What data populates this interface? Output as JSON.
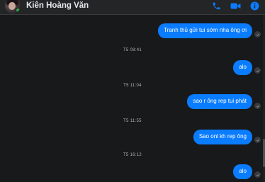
{
  "header": {
    "contact_name": "Kiên Hoàng Văn",
    "icons": [
      "phone-icon",
      "video-camera-icon",
      "info-icon"
    ],
    "accent_color": "#0a7cff"
  },
  "conversation": {
    "messages": [
      {
        "text": "Tranh thủ gửi tui sớm nha ông ơi"
      },
      {
        "text": "alo"
      },
      {
        "text": "sao r ông rep tui phát"
      },
      {
        "text": "Sao onl kh rep ông"
      },
      {
        "text": "alo"
      }
    ],
    "timestamps": [
      "T5 08:41",
      "T5 11:04",
      "T5 11:55",
      "T5 16:12"
    ]
  },
  "colors": {
    "background": "#18191a",
    "outgoing_bubble": "#0a7cff",
    "timestamp_text": "#b0b3b8"
  }
}
